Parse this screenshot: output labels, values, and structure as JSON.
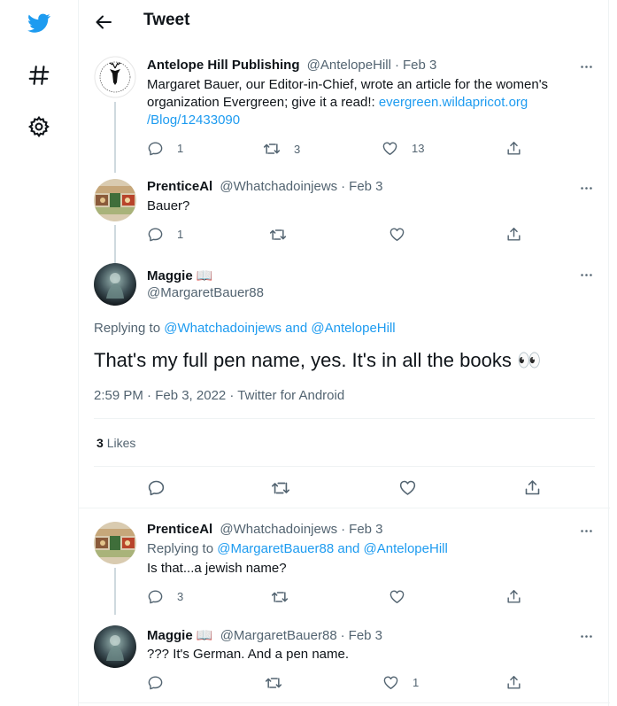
{
  "colors": {
    "accent": "#1d9bf0",
    "text": "#0f1419",
    "muted": "#536471",
    "border": "#eff3f4"
  },
  "nav": {
    "logo_icon": "twitter-bird-icon",
    "explore_icon": "hashtag-icon",
    "settings_icon": "gear-icon"
  },
  "header": {
    "title": "Tweet",
    "back_icon": "back-arrow-icon"
  },
  "tweets": [
    {
      "name": "Antelope Hill Publishing",
      "handle": "@AntelopeHill",
      "date": "Feb 3",
      "text_before": "Margaret Bauer, our Editor-in-Chief, wrote an article for the women's organization Evergreen; give it a read!: ",
      "link_line1": "evergreen.wildapricot.org",
      "link_line2": "/Blog/12433090",
      "replies": "1",
      "retweets": "3",
      "likes": "13"
    },
    {
      "name": "PrenticeAl",
      "handle": "@Whatchadoinjews",
      "date": "Feb 3",
      "text": "Bauer?",
      "replies": "1",
      "retweets": "",
      "likes": ""
    }
  ],
  "main_tweet": {
    "name": "Maggie 📖",
    "handle": "@MargaretBauer88",
    "replying_label": "Replying to ",
    "replying_users": "@Whatchadoinjews and @AntelopeHill",
    "text": "That's my full pen name, yes. It's in all the books 👀",
    "time": "2:59 PM · Feb 3, 2022 · Twitter for Android",
    "likes_count": "3",
    "likes_label": "Likes"
  },
  "replies": [
    {
      "name": "PrenticeAl",
      "handle": "@Whatchadoinjews",
      "date": "Feb 3",
      "replying_label": "Replying to ",
      "replying_users": "@MargaretBauer88 and @AntelopeHill",
      "text": "Is that...a jewish name?",
      "replies": "3",
      "retweets": "",
      "likes": ""
    },
    {
      "name": "Maggie 📖",
      "handle": "@MargaretBauer88",
      "date": "Feb 3",
      "text": "??? It's German. And a pen name.",
      "replies": "",
      "retweets": "",
      "likes": "1"
    }
  ],
  "dot": "·"
}
